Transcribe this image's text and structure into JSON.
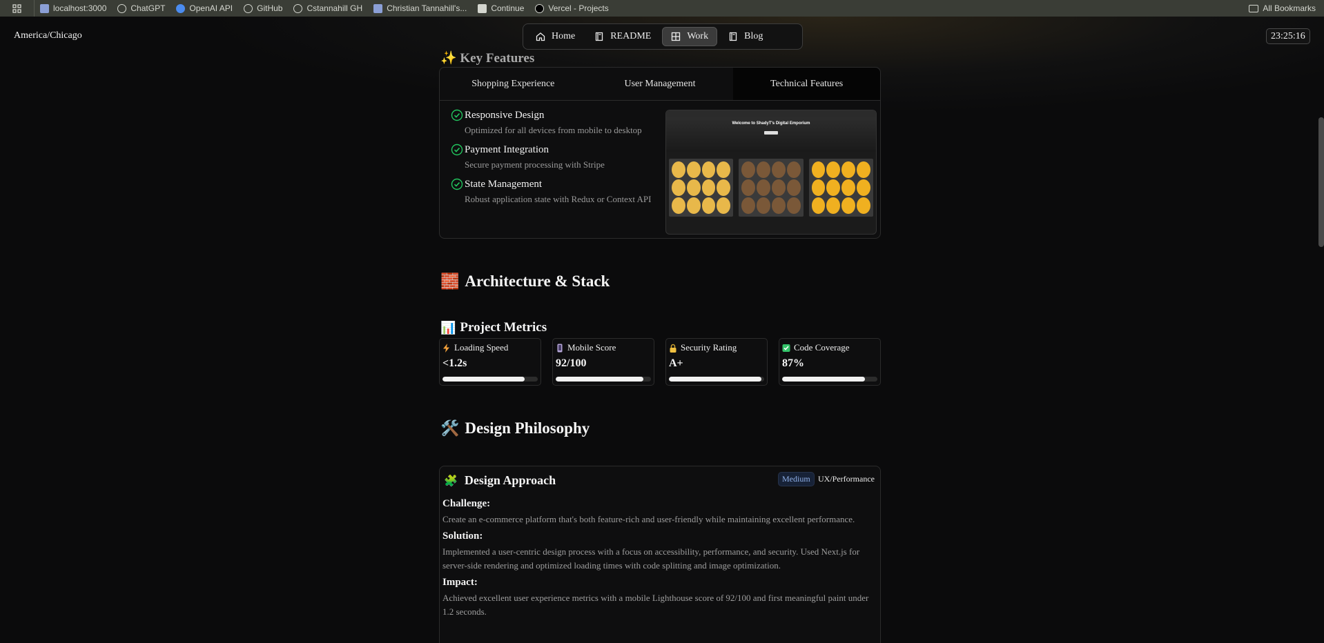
{
  "bookmarks": {
    "items": [
      {
        "label": "localhost:3000",
        "icon": "page-icon",
        "color": "#8b9fd6"
      },
      {
        "label": "ChatGPT",
        "icon": "openai-icon",
        "color": "#d4d6cf"
      },
      {
        "label": "OpenAI API",
        "icon": "openai-icon",
        "color": "#4b8cf0"
      },
      {
        "label": "GitHub",
        "icon": "github-icon",
        "color": "#d4d6cf"
      },
      {
        "label": "Cstannahill GH",
        "icon": "github-icon",
        "color": "#d4d6cf"
      },
      {
        "label": "Christian Tannahill's...",
        "icon": "page-icon",
        "color": "#8b9fd6"
      },
      {
        "label": "Continue",
        "icon": "continue-icon",
        "color": "#d4d6cf"
      },
      {
        "label": "Vercel - Projects",
        "icon": "vercel-icon",
        "color": "#000000"
      }
    ],
    "all_label": "All Bookmarks"
  },
  "header": {
    "timezone": "America/Chicago",
    "clock": "23:25:16",
    "nav": [
      {
        "label": "Home",
        "icon": "home-icon",
        "active": false
      },
      {
        "label": "README",
        "icon": "book-icon",
        "active": false
      },
      {
        "label": "Work",
        "icon": "grid-icon",
        "active": true
      },
      {
        "label": "Blog",
        "icon": "book-icon",
        "active": false
      }
    ]
  },
  "key_features": {
    "title": "✨ Key Features",
    "tabs": [
      "Shopping Experience",
      "User Management",
      "Technical Features"
    ],
    "active_tab": "Technical Features",
    "items": [
      {
        "title": "Responsive Design",
        "desc": "Optimized for all devices from mobile to desktop"
      },
      {
        "title": "Payment Integration",
        "desc": "Secure payment processing with Stripe"
      },
      {
        "title": "State Management",
        "desc": "Robust application state with Redux or Context API"
      }
    ],
    "screenshot_title": "Welcome to ShadyT's Digital Emporium"
  },
  "architecture": {
    "title": "Architecture & Stack",
    "emoji": "🧱"
  },
  "metrics": {
    "title": "Project Metrics",
    "emoji": "📊",
    "items": [
      {
        "label": "Loading Speed",
        "value": "<1.2s",
        "progress": 0.86,
        "icon": "lightning-icon",
        "color": "#f4a13a"
      },
      {
        "label": "Mobile Score",
        "value": "92/100",
        "progress": 0.92,
        "icon": "phone-icon",
        "color": "#b6a7d8"
      },
      {
        "label": "Security Rating",
        "value": "A+",
        "progress": 0.97,
        "icon": "lock-icon",
        "color": "#f0c040"
      },
      {
        "label": "Code Coverage",
        "value": "87%",
        "progress": 0.87,
        "icon": "check-box-icon",
        "color": "#34c46a"
      }
    ]
  },
  "design": {
    "title": "Design Philosophy",
    "emoji": "🛠️",
    "approach": {
      "title": "Design Approach",
      "emoji": "🧩",
      "difficulty": "Medium",
      "category": "UX/Performance",
      "challenge_label": "Challenge:",
      "challenge": "Create an e-commerce platform that's both feature-rich and user-friendly while maintaining excellent performance.",
      "solution_label": "Solution:",
      "solution": "Implemented a user-centric design process with a focus on accessibility, performance, and security. Used Next.js for server-side rendering and optimized loading times with code splitting and image optimization.",
      "impact_label": "Impact:",
      "impact": "Achieved excellent user experience metrics with a mobile Lighthouse score of 92/100 and first meaningful paint under 1.2 seconds."
    }
  }
}
